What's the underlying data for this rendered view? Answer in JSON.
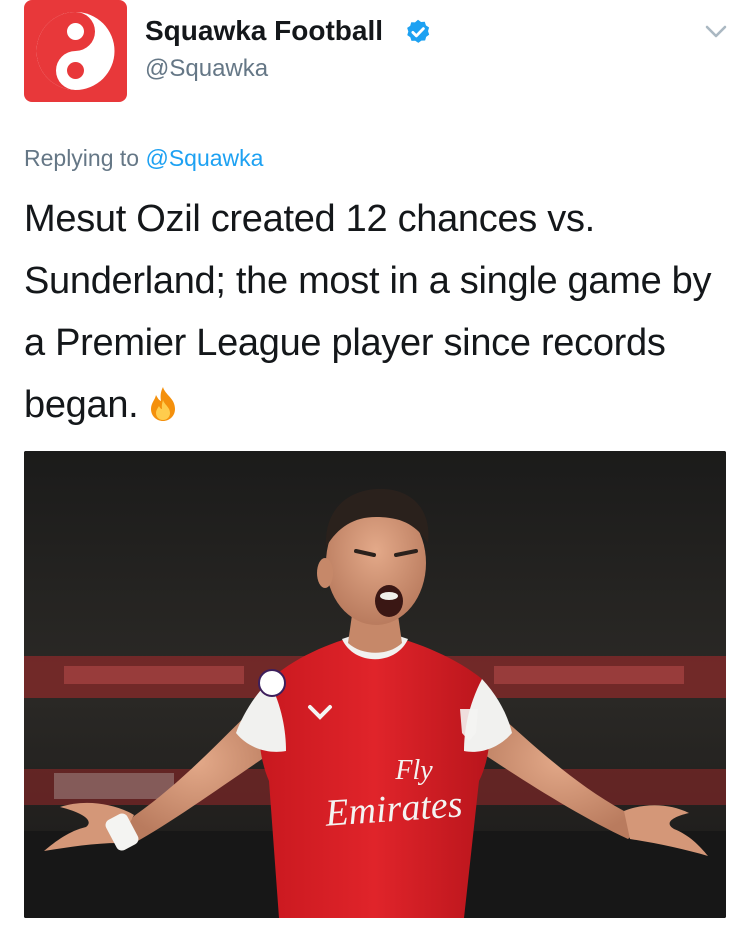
{
  "author": {
    "display_name": "Squawka Football",
    "handle": "@Squawka",
    "verified": true,
    "avatar_icon": "squawka-logo-icon",
    "avatar_color": "#e8383a"
  },
  "reply": {
    "prefix": "Replying to",
    "target": "@Squawka"
  },
  "tweet": {
    "text": "Mesut Ozil created 12 chances vs. Sunderland; the most in a single game by a Premier League player since records began.",
    "emoji_icon": "fire-icon"
  },
  "media": {
    "shirt_sponsor_line1": "Fly",
    "shirt_sponsor_line2": "Emirates"
  },
  "colors": {
    "link": "#1da1f2",
    "verified": "#1da1f2",
    "secondary_text": "#657786",
    "shirt_red": "#e0242a"
  },
  "icons": {
    "verified": "verified-badge-icon",
    "menu": "chevron-down-icon"
  }
}
